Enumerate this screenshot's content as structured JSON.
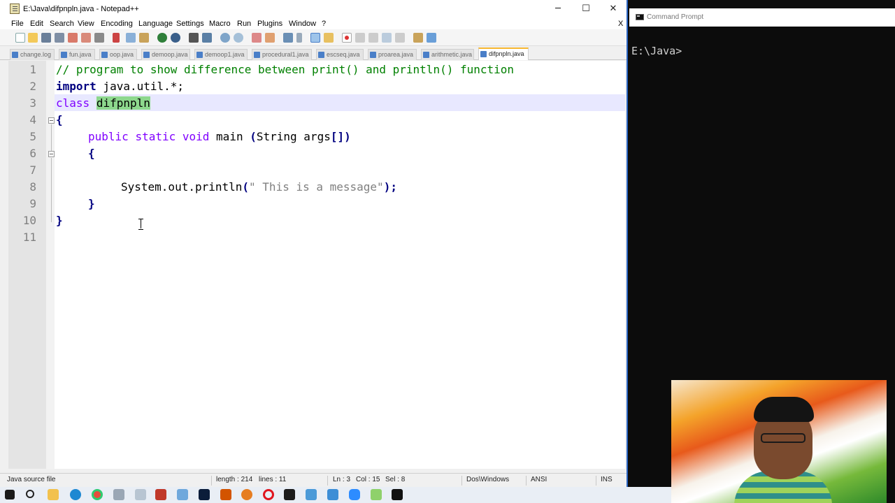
{
  "notepad": {
    "title": "E:\\Java\\difpnpln.java - Notepad++",
    "window_buttons": {
      "minimize": "─",
      "maximize": "☐",
      "close": "✕"
    },
    "menu": [
      "File",
      "Edit",
      "Search",
      "View",
      "Encoding",
      "Language",
      "Settings",
      "Macro",
      "Run",
      "Plugins",
      "Window",
      "?"
    ],
    "menu_close": "X",
    "toolbar_icons": [
      "new-file-icon",
      "open-file-icon",
      "save-icon",
      "save-all-icon",
      "close-icon",
      "close-all-icon",
      "print-icon",
      "cut-icon",
      "copy-icon",
      "paste-icon",
      "undo-icon",
      "redo-icon",
      "find-icon",
      "replace-icon",
      "zoom-in-icon",
      "zoom-out-icon",
      "sync-vertical-icon",
      "sync-horizontal-icon",
      "word-wrap-icon",
      "show-all-chars-icon",
      "indent-guide-icon",
      "user-lang-icon",
      "record-macro-icon",
      "stop-record-icon",
      "play-macro-icon",
      "run-macro-multiple-icon",
      "save-macro-icon",
      "monitoring-icon",
      "spell-check-icon"
    ],
    "tabs": [
      {
        "label": "change.log",
        "active": false
      },
      {
        "label": "fun.java",
        "active": false
      },
      {
        "label": "oop.java",
        "active": false
      },
      {
        "label": "demoop.java",
        "active": false
      },
      {
        "label": "demoop1.java",
        "active": false
      },
      {
        "label": "procedural1.java",
        "active": false
      },
      {
        "label": "escseq.java",
        "active": false
      },
      {
        "label": "proarea.java",
        "active": false
      },
      {
        "label": "arithmetic.java",
        "active": false
      },
      {
        "label": "difpnpln.java",
        "active": true
      }
    ],
    "code_lines": {
      "l1": "// program to show difference between print() and println() function",
      "l2_kw": "import",
      "l2_rest": " java.util.*;",
      "l3_kw": "class",
      "l3_name": "difpnpln",
      "l4": "{",
      "l5_kw1": "public",
      "l5_kw2": "static",
      "l5_kw3": "void",
      "l5_name": "main",
      "l5_paren_open": "(",
      "l5_type": "String",
      "l5_args": "args",
      "l5_close": "[])",
      "l6": "{",
      "l8_obj": "System.out.println",
      "l8_open": "(",
      "l8_str": "\" This is a message\"",
      "l8_close": ");",
      "l9": "}",
      "l10": "}"
    },
    "line_numbers": [
      "1",
      "2",
      "3",
      "4",
      "5",
      "6",
      "7",
      "8",
      "9",
      "10",
      "11"
    ],
    "status": {
      "file_type": "Java source file",
      "length": "length : 214",
      "lines": "lines : 11",
      "ln": "Ln : 3",
      "col": "Col : 15",
      "sel": "Sel : 8",
      "eol": "Dos\\Windows",
      "encoding": "ANSI",
      "mode": "INS"
    }
  },
  "cmd": {
    "title": "Command Prompt",
    "prompt": "E:\\Java>"
  },
  "colors": {
    "comment": "#008000",
    "keyword": "#000080",
    "type_keyword": "#8000ff",
    "string": "#808080",
    "selection": "#8dd88d",
    "current_line": "#e8e8ff",
    "active_tab_accent": "#f8b830"
  },
  "taskbar_icons": [
    "start-icon",
    "search-icon",
    "file-explorer-icon",
    "edge-icon",
    "chrome-icon",
    "app-icon",
    "app-icon",
    "app-icon",
    "photoshop-icon",
    "app-icon",
    "firefox-icon",
    "opera-icon",
    "app-icon",
    "app-icon",
    "app-icon",
    "zoom-icon",
    "notepadpp-icon",
    "cmd-icon"
  ]
}
